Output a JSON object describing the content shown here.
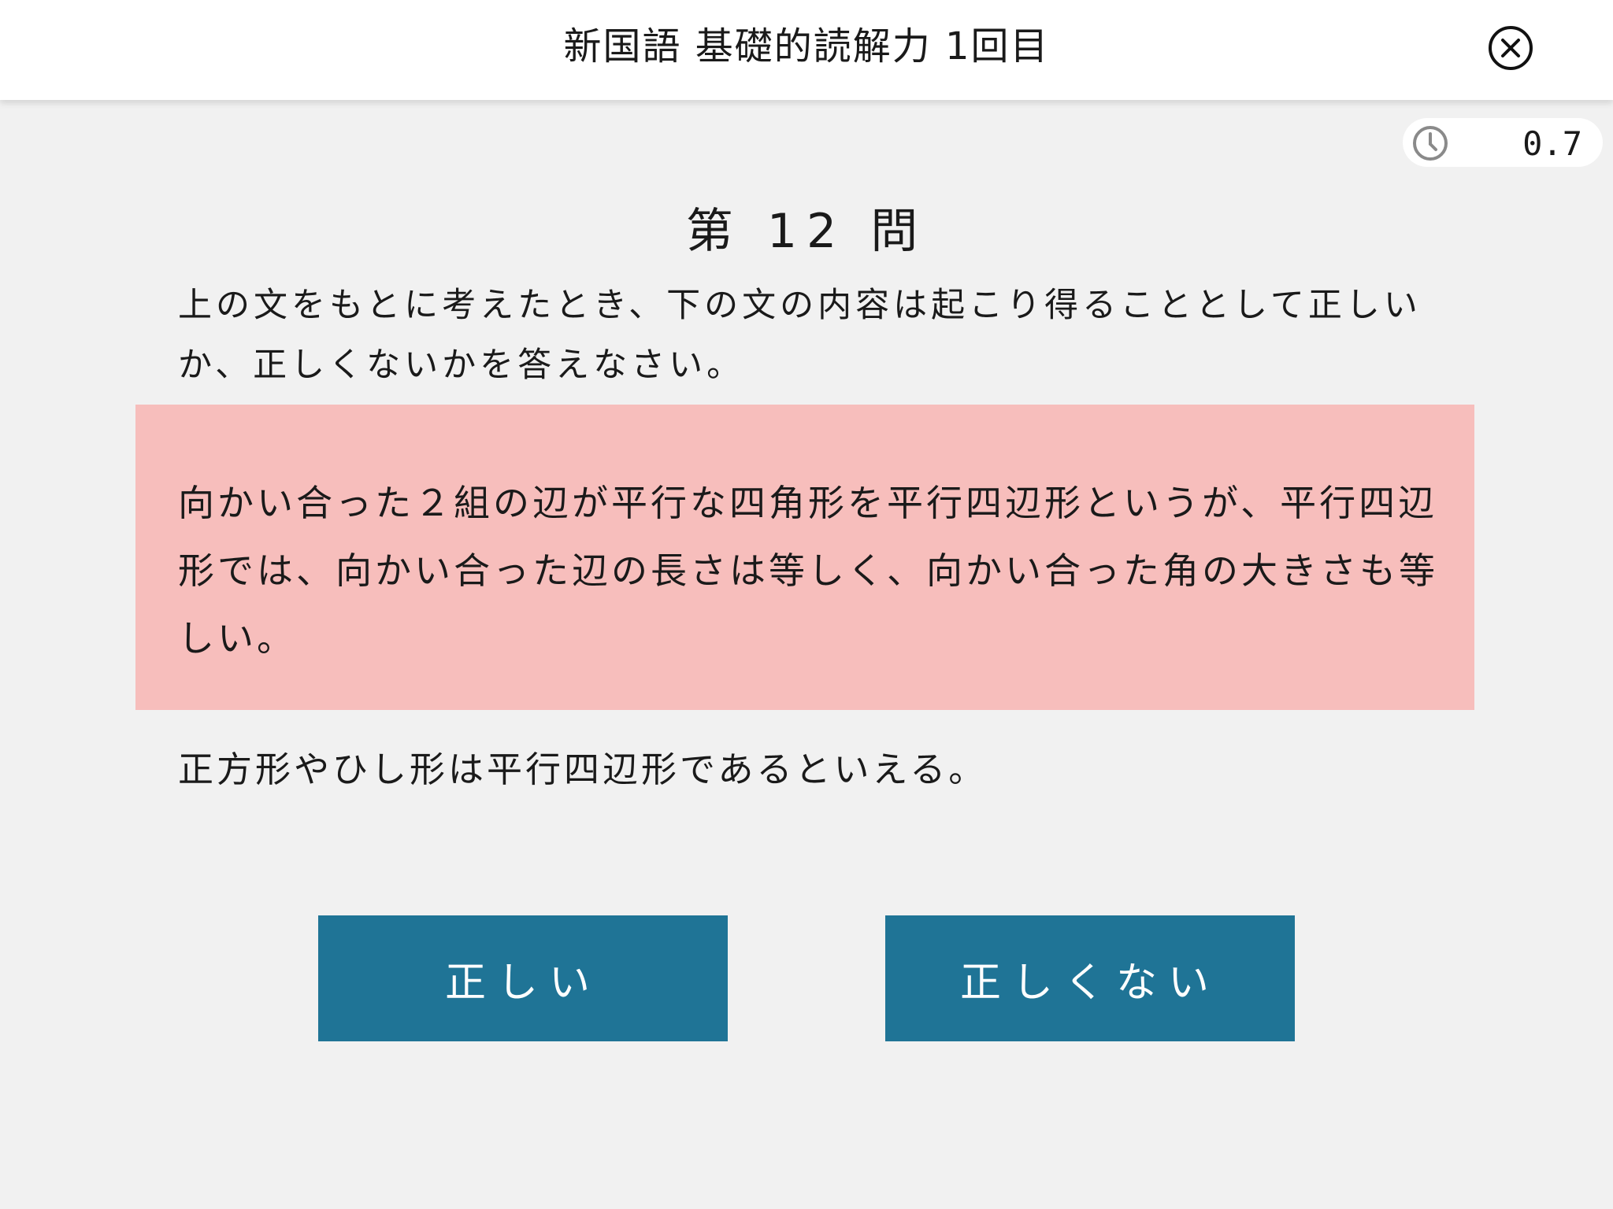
{
  "header": {
    "title": "新国語 基礎的読解力 1回目",
    "close_icon": "close-circle-icon"
  },
  "timer": {
    "icon": "clock-icon",
    "value": "0.7"
  },
  "question": {
    "number_label": "第 12 問",
    "instruction": "上の文をもとに考えたとき、下の文の内容は起こり得ることとして正しいか、正しくないかを答えなさい。",
    "passage": "向かい合った２組の辺が平行な四角形を平行四辺形というが、平行四辺形では、向かい合った辺の長さは等しく、向かい合った角の大きさも等しい。",
    "statement": "正方形やひし形は平行四辺形であるといえる。"
  },
  "answers": {
    "correct_label": "正しい",
    "incorrect_label": "正しくない"
  },
  "colors": {
    "background": "#f1f1f1",
    "passage_background": "#f7bebc",
    "button": "#1f7496",
    "button_text": "#ffffff"
  }
}
